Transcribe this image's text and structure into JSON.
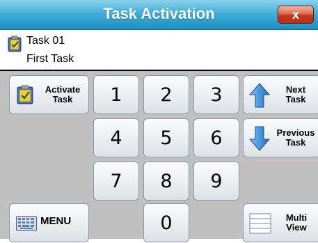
{
  "window": {
    "title": "Task Activation",
    "close_label": "x"
  },
  "task": {
    "id": "Task 01",
    "description": "First Task"
  },
  "keypad": {
    "activate_label_line1": "Activate",
    "activate_label_line2": "Task",
    "digits": [
      "1",
      "2",
      "3",
      "4",
      "5",
      "6",
      "7",
      "8",
      "9",
      "0"
    ],
    "next_label_line1": "Next",
    "next_label_line2": "Task",
    "previous_label_line1": "Previous",
    "previous_label_line2": "Task",
    "menu_label": "MENU",
    "multiview_label_line1": "Multi",
    "multiview_label_line2": "View"
  },
  "colors": {
    "title_bar": "#42aed8",
    "close_button": "#c0381f",
    "keypad_background": "#c0c0c0",
    "arrow_blue": "#2f86d6"
  },
  "icons": [
    "task-clipboard-icon",
    "close-icon",
    "up-arrow-icon",
    "down-arrow-icon",
    "keyboard-icon",
    "list-icon"
  ]
}
